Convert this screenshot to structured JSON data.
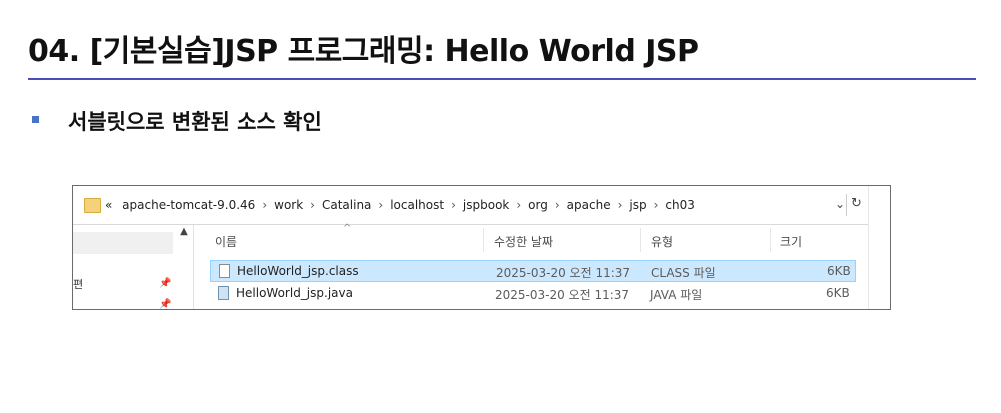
{
  "slide": {
    "title": "04. [기본실습]JSP 프로그래밍: Hello World JSP",
    "subtitle": "서블릿으로 변환된 소스 확인"
  },
  "explorer": {
    "address": {
      "overflow": "«",
      "segments": [
        "apache-tomcat-9.0.46",
        "work",
        "Catalina",
        "localhost",
        "jspbook",
        "org",
        "apache",
        "jsp",
        "ch03"
      ],
      "separator": "›",
      "dropdown": "⌄",
      "refresh": "↻"
    },
    "nav": {
      "partial_text": "편",
      "scroll_up": "▲"
    },
    "columns": {
      "name": "이름",
      "modified": "수정한 날짜",
      "type": "유형",
      "size": "크기",
      "sort_indicator": "^"
    },
    "files": [
      {
        "name": "HelloWorld_jsp.class",
        "modified": "2025-03-20 오전 11:37",
        "type": "CLASS 파일",
        "size": "6KB",
        "selected": true,
        "icon": "file-icon"
      },
      {
        "name": "HelloWorld_jsp.java",
        "modified": "2025-03-20 오전 11:37",
        "type": "JAVA 파일",
        "size": "6KB",
        "selected": false,
        "icon": "java-file-icon"
      }
    ]
  },
  "colors": {
    "title_rule": "#4a4fb7",
    "bullet": "#4a73c7",
    "selection_bg": "#cce8ff",
    "selection_border": "#99d1ff"
  }
}
